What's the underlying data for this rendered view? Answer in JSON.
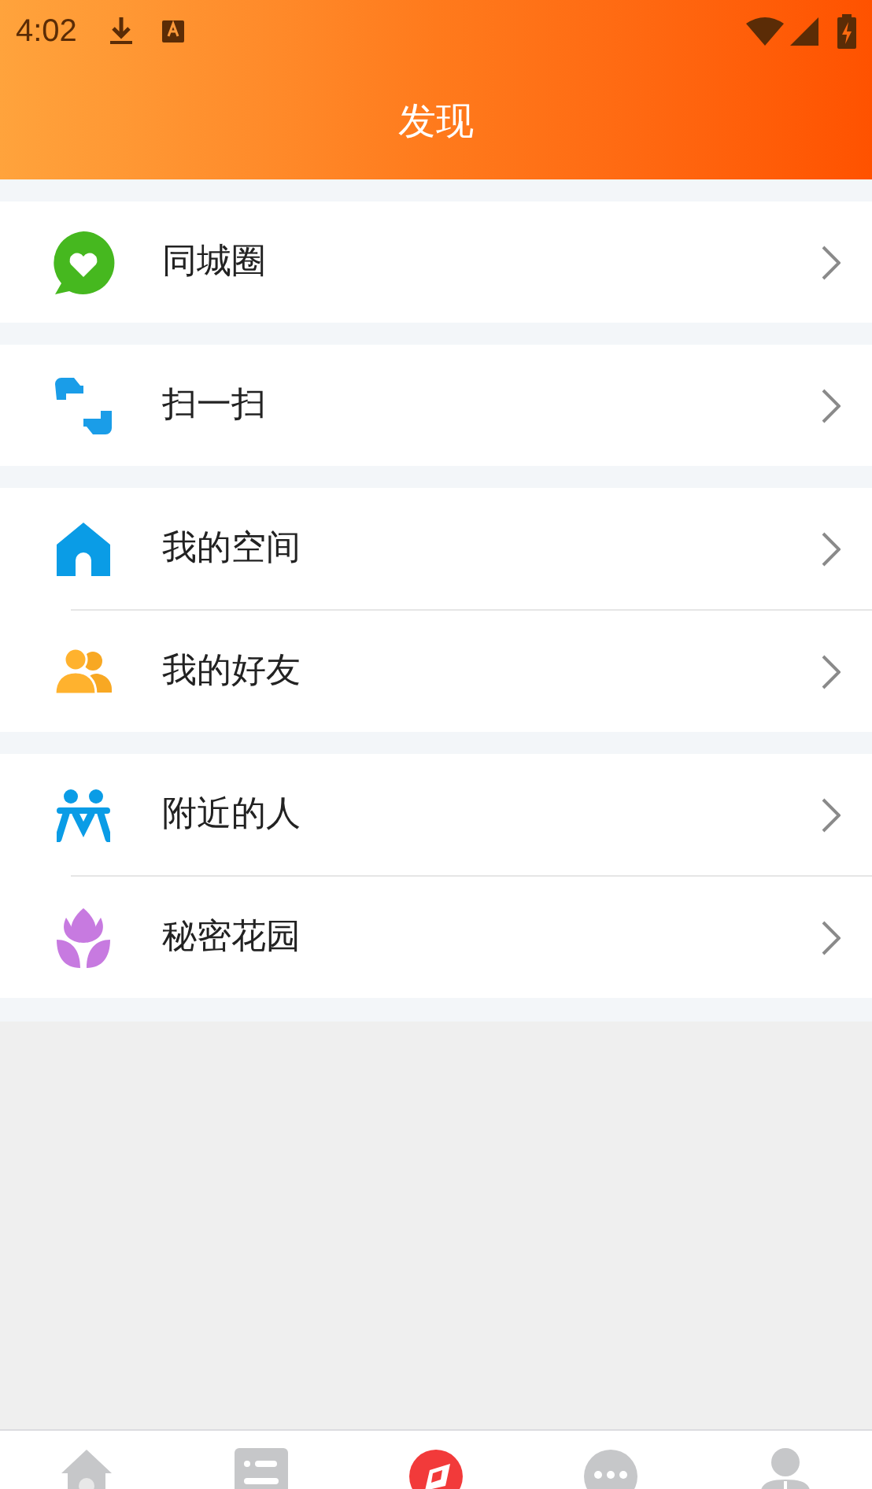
{
  "status_bar": {
    "time": "4:02"
  },
  "header": {
    "title": "发现"
  },
  "groups": [
    {
      "items": [
        {
          "label": "同城圈"
        }
      ]
    },
    {
      "items": [
        {
          "label": "扫一扫"
        }
      ]
    },
    {
      "items": [
        {
          "label": "我的空间"
        },
        {
          "label": "我的好友"
        }
      ]
    },
    {
      "items": [
        {
          "label": "附近的人"
        },
        {
          "label": "秘密花园"
        }
      ]
    }
  ],
  "bottom_nav": [
    {
      "selected": false
    },
    {
      "selected": false
    },
    {
      "selected": true
    },
    {
      "selected": false
    },
    {
      "selected": false
    }
  ]
}
